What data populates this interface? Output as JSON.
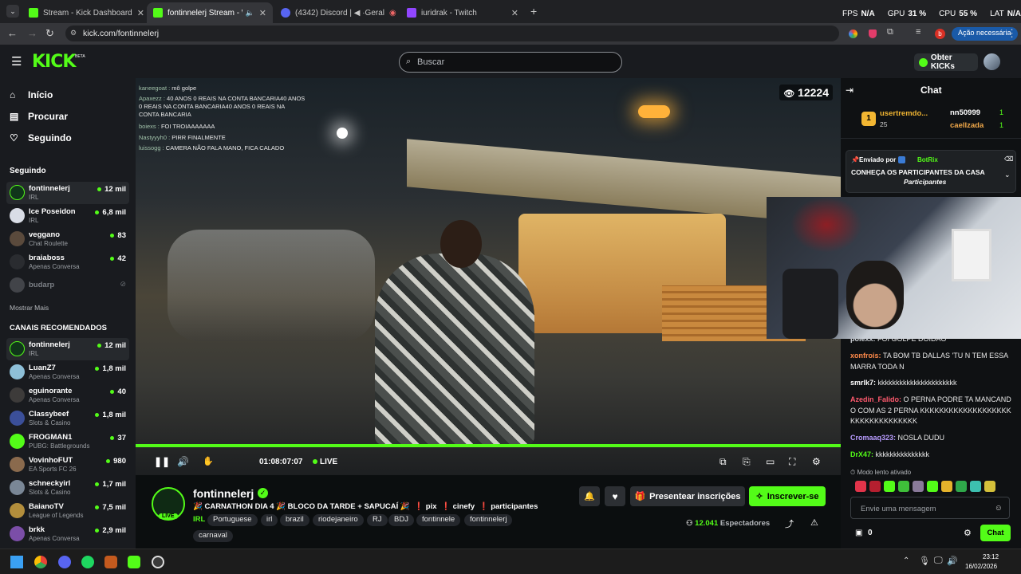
{
  "browser": {
    "tabs": [
      {
        "label": "Stream - Kick Dashboard",
        "color": "#53fc18"
      },
      {
        "label": "fontinnelerj Stream - Watch",
        "color": "#53fc18"
      },
      {
        "label": "(4342) Discord | ◀ ·Geral",
        "color": "#5865f2"
      },
      {
        "label": "iuridrak - Twitch",
        "color": "#9146ff"
      }
    ],
    "new_tab": "+",
    "url": "kick.com/fontinnelerj",
    "action_required": "Ação necessária",
    "profile_initial": "b"
  },
  "hud": {
    "fps_label": "FPS",
    "fps_value": "N/A",
    "gpu_label": "GPU",
    "gpu_value": "31 %",
    "cpu_label": "CPU",
    "cpu_value": "55 %",
    "lat_label": "LAT",
    "lat_value": "N/A"
  },
  "header": {
    "logo": "KICK",
    "logo_badge": "BETA",
    "search_placeholder": "Buscar",
    "get_kicks": "Obter KICKs"
  },
  "sidebar": {
    "nav": [
      {
        "label": "Início",
        "icon": "home-icon"
      },
      {
        "label": "Procurar",
        "icon": "browse-icon"
      },
      {
        "label": "Seguindo",
        "icon": "heart-icon"
      }
    ],
    "following_title": "Seguindo",
    "following": [
      {
        "name": "fontinnelerj",
        "category": "IRL",
        "viewers": "12 mil",
        "live": true
      },
      {
        "name": "Ice Poseidon",
        "category": "IRL",
        "viewers": "6,8 mil",
        "live": true
      },
      {
        "name": "veggano",
        "category": "Chat Roulette",
        "viewers": "83",
        "live": true
      },
      {
        "name": "braiaboss",
        "category": "Apenas Conversa",
        "viewers": "42",
        "live": true
      },
      {
        "name": "budarp",
        "category": "",
        "viewers": "",
        "live": false
      }
    ],
    "show_more": "Mostrar Mais",
    "recommended_title": "CANAIS RECOMENDADOS",
    "recommended": [
      {
        "name": "fontinnelerj",
        "category": "IRL",
        "viewers": "12 mil"
      },
      {
        "name": "LuanZ7",
        "category": "Apenas Conversa",
        "viewers": "1,8 mil"
      },
      {
        "name": "eguinorante",
        "category": "Apenas Conversa",
        "viewers": "40"
      },
      {
        "name": "Classybeef",
        "category": "Slots & Casino",
        "viewers": "1,8 mil"
      },
      {
        "name": "FROGMAN1",
        "category": "PUBG: Battlegrounds",
        "viewers": "37"
      },
      {
        "name": "VovinhoFUT",
        "category": "EA Sports FC 26",
        "viewers": "980"
      },
      {
        "name": "schneckyirl",
        "category": "Slots & Casino",
        "viewers": "1,7 mil"
      },
      {
        "name": "BaianoTV",
        "category": "League of Legends",
        "viewers": "7,5 mil"
      },
      {
        "name": "brkk",
        "category": "Apenas Conversa",
        "viewers": "2,9 mil"
      }
    ]
  },
  "player": {
    "viewer_count": "12224",
    "timestamp": "01:08:07:07",
    "live_label": "LIVE",
    "progress_fraction": 1.0,
    "overlay_chat": [
      {
        "user": "kaneegoat :",
        "text": "mô golpe"
      },
      {
        "user": "Apaxezz :",
        "text": "40 ANOS 0 REAIS NA CONTA BANCARIA40 ANOS 0 REAIS NA CONTA BANCARIA40 ANOS 0 REAIS NA CONTA BANCARIA"
      },
      {
        "user": "boiexs :",
        "text": "FOI TROIAAAAAAA"
      },
      {
        "user": "Nastyyyh0 :",
        "text": "PIRR FINALMENTE"
      },
      {
        "user": "luissogg :",
        "text": "CAMERA NÃO FALA MANO, FICA CALADO"
      }
    ]
  },
  "stream": {
    "channel": "fontinnelerj",
    "live_badge": "LIVE",
    "title_parts": [
      "🎉 CARNATHON DIA 4 🎉 BLOCO DA TARDE + SAPUCAÍ 🎉",
      "❗ pix",
      "❗ cinefy",
      "❗ participantes"
    ],
    "category": "IRL",
    "tags": [
      "Portuguese",
      "irl",
      "brazil",
      "riodejaneiro",
      "RJ",
      "BDJ",
      "fontinnele",
      "fontinnelerj",
      "carnaval"
    ],
    "gift_button": "Presentear inscrições",
    "subscribe_button": "Inscrever-se",
    "spectators_count": "12.041",
    "spectators_label": "Espectadores"
  },
  "chat": {
    "title": "Chat",
    "leaderboard": [
      {
        "rank": "1",
        "name": "usertremdo...",
        "amount": "25"
      },
      {
        "name": "nn50999",
        "amount": "1"
      },
      {
        "name": "caellzada",
        "amount": "1"
      }
    ],
    "pinned_by_label": "Enviado por",
    "pinned_by": "BotRix",
    "pinned_text": "CONHEÇA OS PARTICIPANTES DA CASA",
    "pinned_link": "Participantes",
    "messages": [
      {
        "user": "polexx:",
        "text": "FOI GOLPE DOIDAO",
        "color": "#cfd3d8"
      },
      {
        "user": "xonfrois:",
        "text": "TA BOM TB DALLAS 'TU N TEM ESSA MARRA TODA N",
        "color": "#ff8a4a"
      },
      {
        "user": "smrlk7:",
        "text": "kkkkkkkkkkkkkkkkkkkkkk",
        "color": "#ffffff"
      },
      {
        "user": "Azedin_Falido:",
        "text": "O PERNA PODRE TA MANCANDO COM AS 2 PERNA KKKKKKKKKKKKKKKKKKKKKKKKKKKKKKKKK",
        "color": "#ff5a6e"
      },
      {
        "user": "Cromaaq323:",
        "text": "NOSLA DUDU",
        "color": "#b89cff"
      },
      {
        "user": "DrX47:",
        "text": "kkkkkkkkkkkkkkk",
        "color": "#53fc18"
      }
    ],
    "slow_mode": "Modo lento ativado",
    "input_placeholder": "Envie uma mensagem",
    "points": "0",
    "send_button": "Chat"
  },
  "taskbar": {
    "time": "23:12",
    "date": "16/02/2026"
  }
}
